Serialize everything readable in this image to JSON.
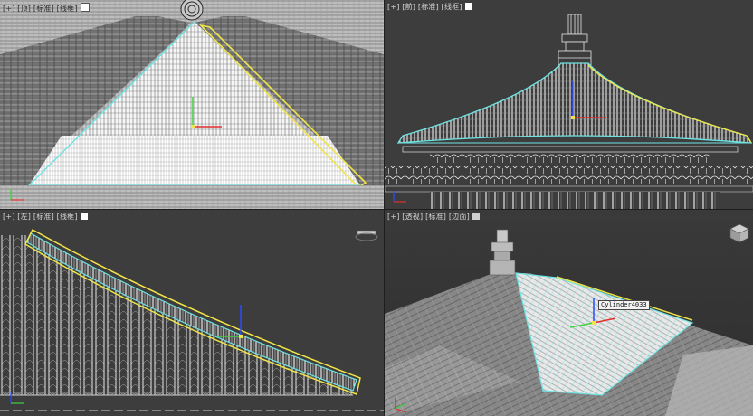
{
  "viewports": {
    "top": {
      "label": "[+] [顶] [标准] [线框]",
      "active": false
    },
    "front": {
      "label": "[+] [前] [标准] [线框]",
      "active": false
    },
    "left": {
      "label": "[+] [左] [标准] [线框]",
      "active": false
    },
    "perspective": {
      "label": "[+] [透视] [标准] [边面]",
      "active": true
    }
  },
  "selection": {
    "object_name": "Cylinder4033"
  },
  "colors": {
    "viewport_bg": "#3d3d3d",
    "top_bg": "#b9b9b9",
    "wire_white": "#ffffff",
    "selection_cyan": "#6fe3e3",
    "selection_yellow": "#f0e44a",
    "gizmo_blue": "#2a4bff",
    "gizmo_green": "#3cd23c",
    "gizmo_red": "#e03030",
    "active_border": "#f0c800"
  },
  "icons": [
    "view-cube-icon",
    "axis-tripod-icon",
    "pivot-gizmo-icon"
  ]
}
